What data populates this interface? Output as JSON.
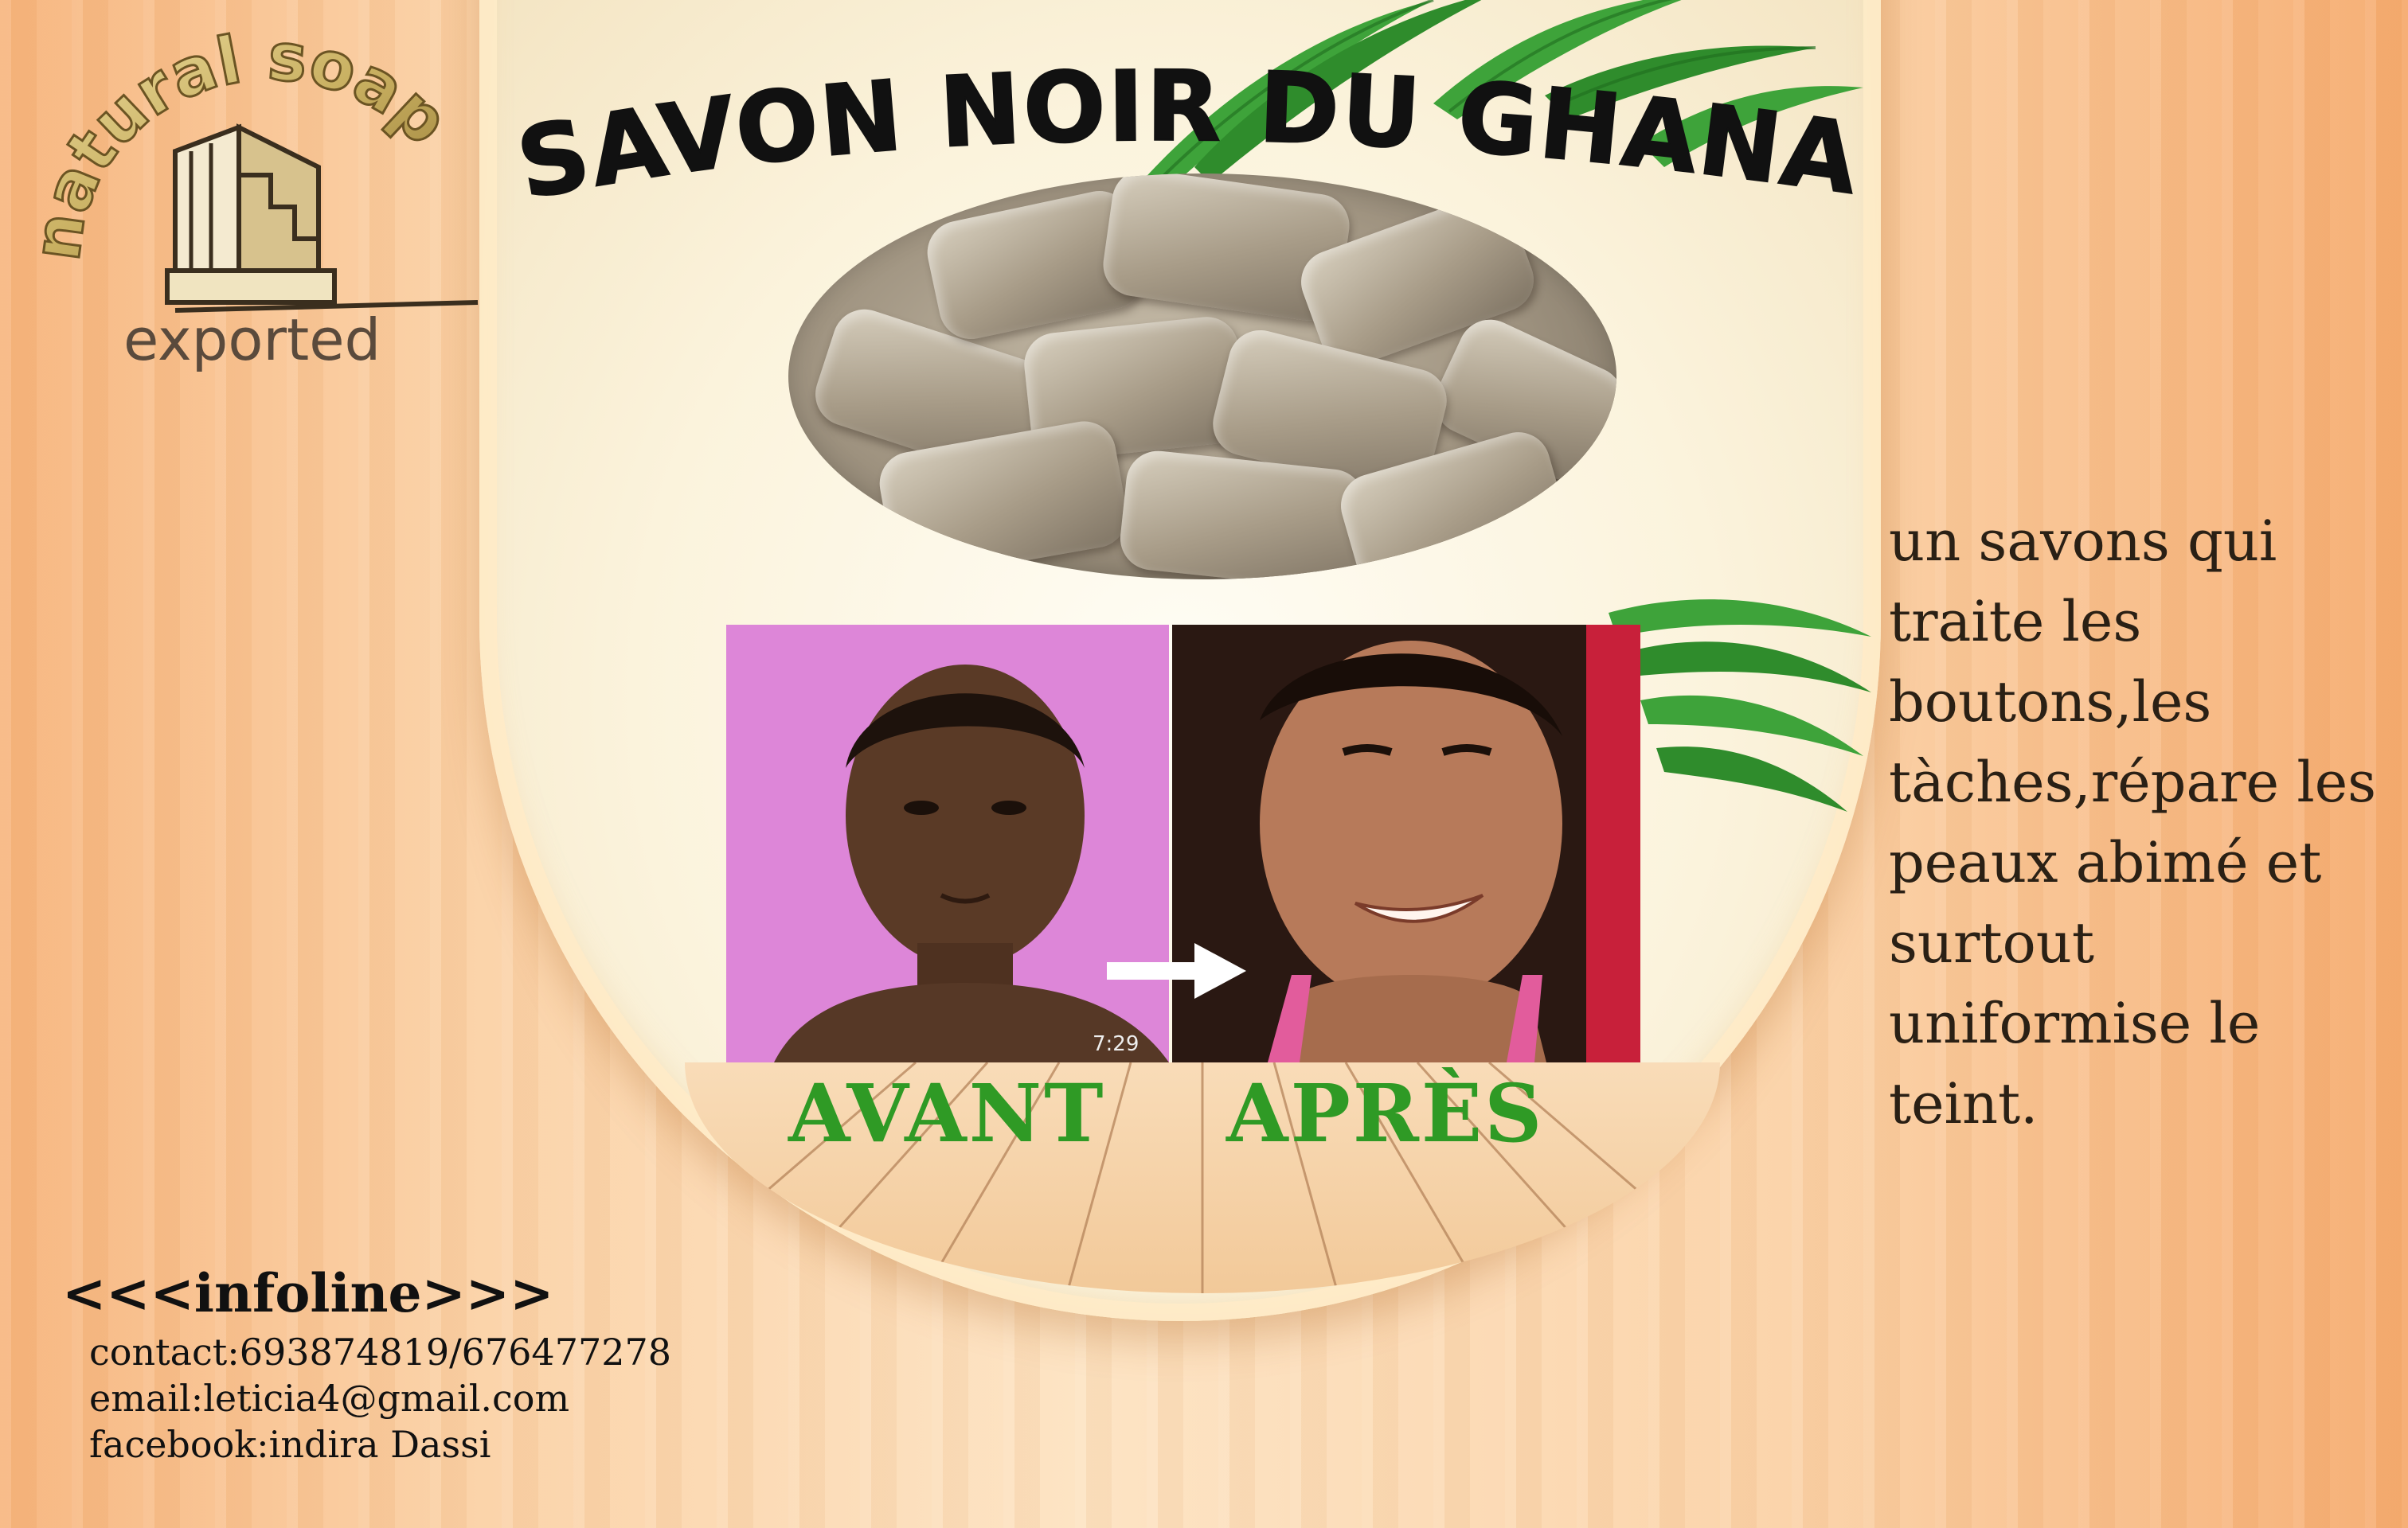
{
  "brand": {
    "logo_text": "natural soap",
    "subtitle": "exported"
  },
  "title": "SAVON NOIR DU GHANA",
  "captions": {
    "before": "AVANT",
    "after": "APRÈS"
  },
  "photo_timestamp": "7:29",
  "description": [
    "un savons qui",
    "traite les",
    "boutons,les",
    "tàches,répare les",
    "peaux abimé et",
    "surtout",
    "uniformise le",
    "teint."
  ],
  "infoline": {
    "heading": "<<<infoline>>>",
    "contact": "contact:693874819/676477278",
    "email": "email:leticia4@gmail.com",
    "facebook": "facebook:indira Dassi"
  },
  "colors": {
    "caption_green": "#2f9a25",
    "title_black": "#111111",
    "background_peach": "#fbd2a7",
    "logo_gold": "#c9b061"
  }
}
